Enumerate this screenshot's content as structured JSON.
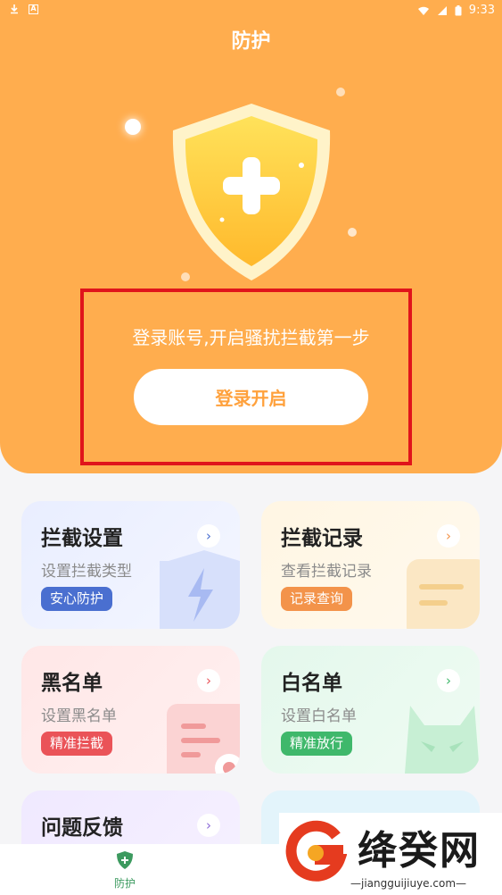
{
  "status_bar": {
    "time": "9:33"
  },
  "header": {
    "title": "防护"
  },
  "login": {
    "hint": "登录账号,开启骚扰拦截第一步",
    "button_label": "登录开启"
  },
  "cards": [
    {
      "title": "拦截设置",
      "subtitle": "设置拦截类型",
      "tag": "安心防护",
      "tag_color": "#4a6fd0"
    },
    {
      "title": "拦截记录",
      "subtitle": "查看拦截记录",
      "tag": "记录查询",
      "tag_color": "#f3934a"
    },
    {
      "title": "黑名单",
      "subtitle": "设置黑名单",
      "tag": "精准拦截",
      "tag_color": "#ea5358"
    },
    {
      "title": "白名单",
      "subtitle": "设置白名单",
      "tag": "精准放行",
      "tag_color": "#3fb86b"
    },
    {
      "title": "问题反馈"
    }
  ],
  "bottom_nav": {
    "items": [
      {
        "label": "防护",
        "icon": "shield-plus-icon"
      }
    ]
  },
  "watermark": {
    "brand": "绛癸网",
    "url": "jiangguijiuye.com"
  },
  "colors": {
    "accent": "#ffad4e",
    "highlight_box": "#e0141b"
  }
}
